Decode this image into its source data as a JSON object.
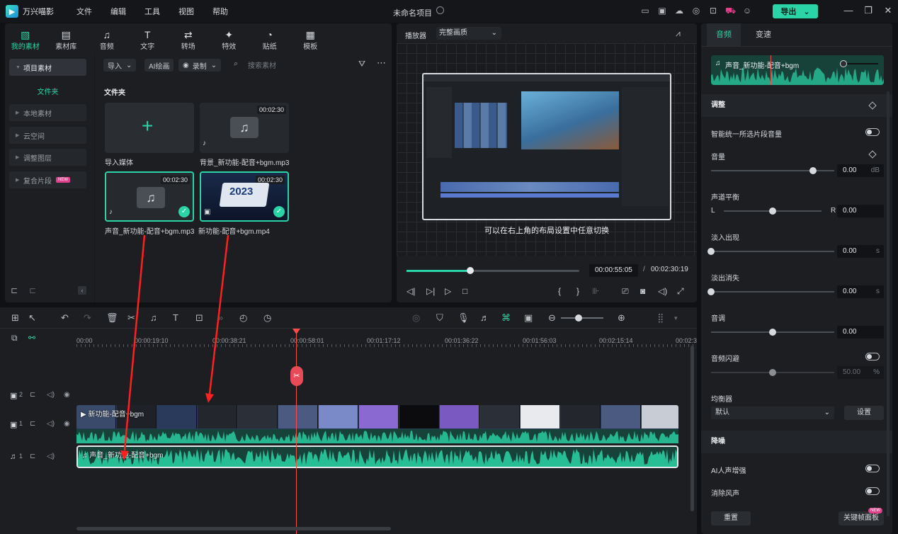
{
  "app": {
    "name": "万兴喵影",
    "project_title": "未命名项目",
    "export_label": "导出"
  },
  "menu": [
    "文件",
    "编辑",
    "工具",
    "视图",
    "帮助"
  ],
  "library": {
    "tabs": [
      {
        "label": "我的素材",
        "icon": "media-icon"
      },
      {
        "label": "素材库",
        "icon": "stock-icon"
      },
      {
        "label": "音频",
        "icon": "music-icon"
      },
      {
        "label": "文字",
        "icon": "text-icon"
      },
      {
        "label": "转场",
        "icon": "transition-icon"
      },
      {
        "label": "特效",
        "icon": "effects-icon"
      },
      {
        "label": "贴纸",
        "icon": "sticker-icon"
      },
      {
        "label": "模板",
        "icon": "template-icon"
      }
    ],
    "sidebar": {
      "head": "项目素材",
      "sub": "文件夹",
      "items": [
        "本地素材",
        "云空间",
        "调整图层",
        "复合片段"
      ],
      "new_badge": "NEW"
    },
    "toolbar": {
      "import": "导入",
      "ai": "AI绘画",
      "record": "录制",
      "search_placeholder": "搜索素材"
    },
    "folder_title": "文件夹",
    "items": [
      {
        "caption": "导入媒体",
        "duration": ""
      },
      {
        "caption": "背景_新功能-配音+bgm.mp3",
        "duration": "00:02:30"
      },
      {
        "caption": "声音_新功能-配音+bgm.mp3",
        "duration": "00:02:30"
      },
      {
        "caption": "新功能-配音+bgm.mp4",
        "duration": "00:02:30",
        "thumb_text": "2023"
      }
    ]
  },
  "player": {
    "label": "播放器",
    "quality": "完整画质",
    "subtitle": "可以在右上角的布局设置中任意切换",
    "current": "00:00:55:05",
    "separator": "/",
    "total": "00:02:30:19",
    "progress": 0.37
  },
  "inspector": {
    "tabs": [
      "音频",
      "变速"
    ],
    "clip_name": "声音_新功能-配音+bgm",
    "section_adjust": "调整",
    "auto_normalize": "智能统一所选片段音量",
    "volume": {
      "label": "音量",
      "value": "0.00",
      "unit": "dB",
      "position": 0.83
    },
    "balance": {
      "label": "声道平衡",
      "left": "L",
      "right": "R",
      "value": "0.00",
      "position": 0.5
    },
    "fade_in": {
      "label": "淡入出现",
      "value": "0.00",
      "unit": "s",
      "position": 0
    },
    "fade_out": {
      "label": "淡出消失",
      "value": "0.00",
      "unit": "s",
      "position": 0
    },
    "pitch": {
      "label": "音调",
      "value": "0.00",
      "position": 0.5
    },
    "ducking": {
      "label": "音频闪避",
      "value": "50.00",
      "unit": "%",
      "position": 0.5
    },
    "equalizer": {
      "label": "均衡器",
      "preset": "默认",
      "setting_btn": "设置"
    },
    "section_denoise": "降噪",
    "ai_voice": "AI人声增强",
    "wind": "消除风声",
    "reset": "重置",
    "keyframe": "关键帧面板",
    "keyframe_badge": "NEW"
  },
  "timeline": {
    "ticks": [
      "00:00",
      "00:00:19:10",
      "00:00:38:21",
      "00:00:58:01",
      "00:01:17:12",
      "00:01:36:22",
      "00:01:56:03",
      "00:02:15:14",
      "00:02:3"
    ],
    "tracks": [
      {
        "index": "2",
        "type": "video"
      },
      {
        "index": "1",
        "type": "video"
      },
      {
        "index": "1",
        "type": "audio"
      }
    ],
    "video_clip": "新功能-配音+bgm",
    "audio_clip": "声音_新功能-配音+bgm"
  },
  "colors": {
    "accent": "#2bd4a6",
    "playhead": "#ff4a4a",
    "arrow": "#ff2020"
  }
}
